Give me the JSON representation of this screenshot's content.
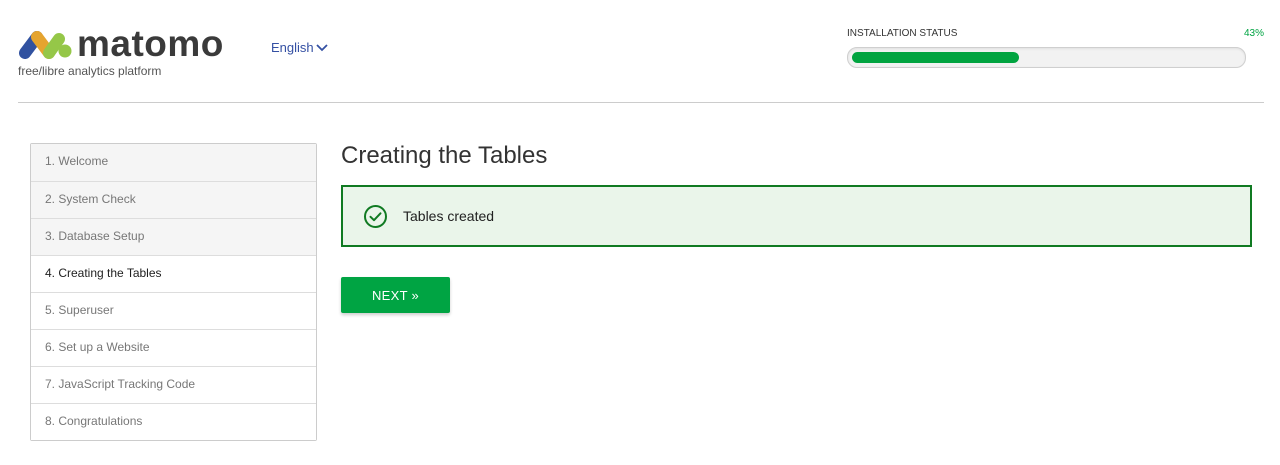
{
  "brand": {
    "name": "matomo",
    "tagline": "free/libre analytics platform",
    "logo_icon": "matomo-logo-icon"
  },
  "language": {
    "selected": "English",
    "icon": "chevron-down-icon"
  },
  "installation_status": {
    "label": "INSTALLATION STATUS",
    "percent_text": "43%",
    "progress": 0.43,
    "bar_color": "#01a440"
  },
  "steps": [
    {
      "label": "1. Welcome"
    },
    {
      "label": "2. System Check"
    },
    {
      "label": "3. Database Setup"
    },
    {
      "label": "4. Creating the Tables"
    },
    {
      "label": "5. Superuser"
    },
    {
      "label": "6. Set up a Website"
    },
    {
      "label": "7. JavaScript Tracking Code"
    },
    {
      "label": "8. Congratulations"
    }
  ],
  "main": {
    "title": "Creating the Tables",
    "alert_text": "Tables created",
    "alert_icon": "check-circle-icon",
    "next_label": "NEXT »"
  },
  "colors": {
    "accent_green": "#00a443",
    "alert_border": "#107a22",
    "alert_bg": "#eaf5ea",
    "link_blue": "#3450a3"
  }
}
